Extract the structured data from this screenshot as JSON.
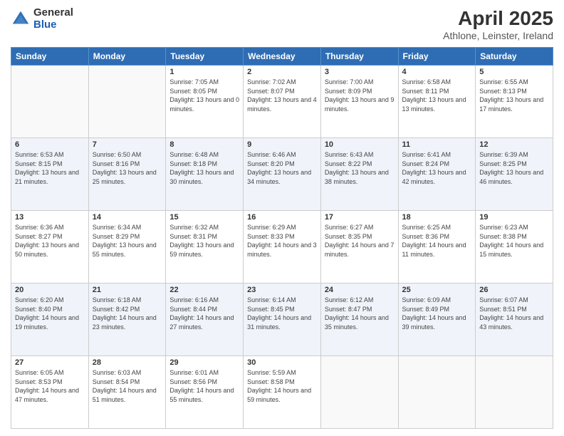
{
  "logo": {
    "general": "General",
    "blue": "Blue"
  },
  "header": {
    "title": "April 2025",
    "subtitle": "Athlone, Leinster, Ireland"
  },
  "weekdays": [
    "Sunday",
    "Monday",
    "Tuesday",
    "Wednesday",
    "Thursday",
    "Friday",
    "Saturday"
  ],
  "weeks": [
    [
      {
        "day": "",
        "info": ""
      },
      {
        "day": "",
        "info": ""
      },
      {
        "day": "1",
        "info": "Sunrise: 7:05 AM\nSunset: 8:05 PM\nDaylight: 13 hours and 0 minutes."
      },
      {
        "day": "2",
        "info": "Sunrise: 7:02 AM\nSunset: 8:07 PM\nDaylight: 13 hours and 4 minutes."
      },
      {
        "day": "3",
        "info": "Sunrise: 7:00 AM\nSunset: 8:09 PM\nDaylight: 13 hours and 9 minutes."
      },
      {
        "day": "4",
        "info": "Sunrise: 6:58 AM\nSunset: 8:11 PM\nDaylight: 13 hours and 13 minutes."
      },
      {
        "day": "5",
        "info": "Sunrise: 6:55 AM\nSunset: 8:13 PM\nDaylight: 13 hours and 17 minutes."
      }
    ],
    [
      {
        "day": "6",
        "info": "Sunrise: 6:53 AM\nSunset: 8:15 PM\nDaylight: 13 hours and 21 minutes."
      },
      {
        "day": "7",
        "info": "Sunrise: 6:50 AM\nSunset: 8:16 PM\nDaylight: 13 hours and 25 minutes."
      },
      {
        "day": "8",
        "info": "Sunrise: 6:48 AM\nSunset: 8:18 PM\nDaylight: 13 hours and 30 minutes."
      },
      {
        "day": "9",
        "info": "Sunrise: 6:46 AM\nSunset: 8:20 PM\nDaylight: 13 hours and 34 minutes."
      },
      {
        "day": "10",
        "info": "Sunrise: 6:43 AM\nSunset: 8:22 PM\nDaylight: 13 hours and 38 minutes."
      },
      {
        "day": "11",
        "info": "Sunrise: 6:41 AM\nSunset: 8:24 PM\nDaylight: 13 hours and 42 minutes."
      },
      {
        "day": "12",
        "info": "Sunrise: 6:39 AM\nSunset: 8:25 PM\nDaylight: 13 hours and 46 minutes."
      }
    ],
    [
      {
        "day": "13",
        "info": "Sunrise: 6:36 AM\nSunset: 8:27 PM\nDaylight: 13 hours and 50 minutes."
      },
      {
        "day": "14",
        "info": "Sunrise: 6:34 AM\nSunset: 8:29 PM\nDaylight: 13 hours and 55 minutes."
      },
      {
        "day": "15",
        "info": "Sunrise: 6:32 AM\nSunset: 8:31 PM\nDaylight: 13 hours and 59 minutes."
      },
      {
        "day": "16",
        "info": "Sunrise: 6:29 AM\nSunset: 8:33 PM\nDaylight: 14 hours and 3 minutes."
      },
      {
        "day": "17",
        "info": "Sunrise: 6:27 AM\nSunset: 8:35 PM\nDaylight: 14 hours and 7 minutes."
      },
      {
        "day": "18",
        "info": "Sunrise: 6:25 AM\nSunset: 8:36 PM\nDaylight: 14 hours and 11 minutes."
      },
      {
        "day": "19",
        "info": "Sunrise: 6:23 AM\nSunset: 8:38 PM\nDaylight: 14 hours and 15 minutes."
      }
    ],
    [
      {
        "day": "20",
        "info": "Sunrise: 6:20 AM\nSunset: 8:40 PM\nDaylight: 14 hours and 19 minutes."
      },
      {
        "day": "21",
        "info": "Sunrise: 6:18 AM\nSunset: 8:42 PM\nDaylight: 14 hours and 23 minutes."
      },
      {
        "day": "22",
        "info": "Sunrise: 6:16 AM\nSunset: 8:44 PM\nDaylight: 14 hours and 27 minutes."
      },
      {
        "day": "23",
        "info": "Sunrise: 6:14 AM\nSunset: 8:45 PM\nDaylight: 14 hours and 31 minutes."
      },
      {
        "day": "24",
        "info": "Sunrise: 6:12 AM\nSunset: 8:47 PM\nDaylight: 14 hours and 35 minutes."
      },
      {
        "day": "25",
        "info": "Sunrise: 6:09 AM\nSunset: 8:49 PM\nDaylight: 14 hours and 39 minutes."
      },
      {
        "day": "26",
        "info": "Sunrise: 6:07 AM\nSunset: 8:51 PM\nDaylight: 14 hours and 43 minutes."
      }
    ],
    [
      {
        "day": "27",
        "info": "Sunrise: 6:05 AM\nSunset: 8:53 PM\nDaylight: 14 hours and 47 minutes."
      },
      {
        "day": "28",
        "info": "Sunrise: 6:03 AM\nSunset: 8:54 PM\nDaylight: 14 hours and 51 minutes."
      },
      {
        "day": "29",
        "info": "Sunrise: 6:01 AM\nSunset: 8:56 PM\nDaylight: 14 hours and 55 minutes."
      },
      {
        "day": "30",
        "info": "Sunrise: 5:59 AM\nSunset: 8:58 PM\nDaylight: 14 hours and 59 minutes."
      },
      {
        "day": "",
        "info": ""
      },
      {
        "day": "",
        "info": ""
      },
      {
        "day": "",
        "info": ""
      }
    ]
  ]
}
